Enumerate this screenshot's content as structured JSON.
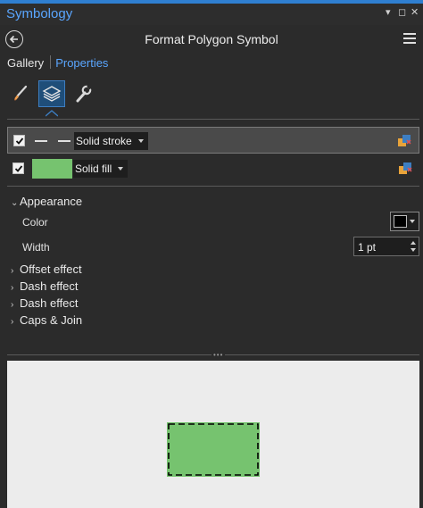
{
  "pane": {
    "title": "Symbology",
    "controls": {
      "pin_glyph": "▾",
      "float_glyph": "◻",
      "close_glyph": "✕"
    }
  },
  "header": {
    "title": "Format Polygon Symbol",
    "back_icon": "back-arrow-circle-icon",
    "menu_icon": "hamburger-menu-icon"
  },
  "tabs": [
    {
      "label": "Gallery",
      "active": false
    },
    {
      "label": "Properties",
      "active": true
    }
  ],
  "symbol_tools": [
    {
      "icon": "paintbrush-icon",
      "selected": false
    },
    {
      "icon": "layers-icon",
      "selected": true
    },
    {
      "icon": "wrench-icon",
      "selected": false
    }
  ],
  "layers": [
    {
      "type": "Solid stroke",
      "checked": true,
      "selected": true,
      "preview": "dashed-line",
      "action_icon": "layer-properties-icon"
    },
    {
      "type": "Solid fill",
      "checked": true,
      "selected": false,
      "preview": "green-fill",
      "preview_color": "#76c36f",
      "action_icon": "layer-properties-icon"
    }
  ],
  "appearance": {
    "heading": "Appearance",
    "expanded": true,
    "color_label": "Color",
    "color_value": "#000000",
    "width_label": "Width",
    "width_value": "1 pt"
  },
  "collapsed_sections": [
    "Offset effect",
    "Dash effect",
    "Dash effect",
    "Caps & Join"
  ],
  "preview": {
    "background": "#ececec",
    "fill_color": "#76c36f",
    "stroke_color": "#000000",
    "stroke_style": "dashed"
  },
  "colors": {
    "accent": "#5aa6ff",
    "selection": "#1f4e79",
    "panel_bg": "#2b2b2b"
  }
}
